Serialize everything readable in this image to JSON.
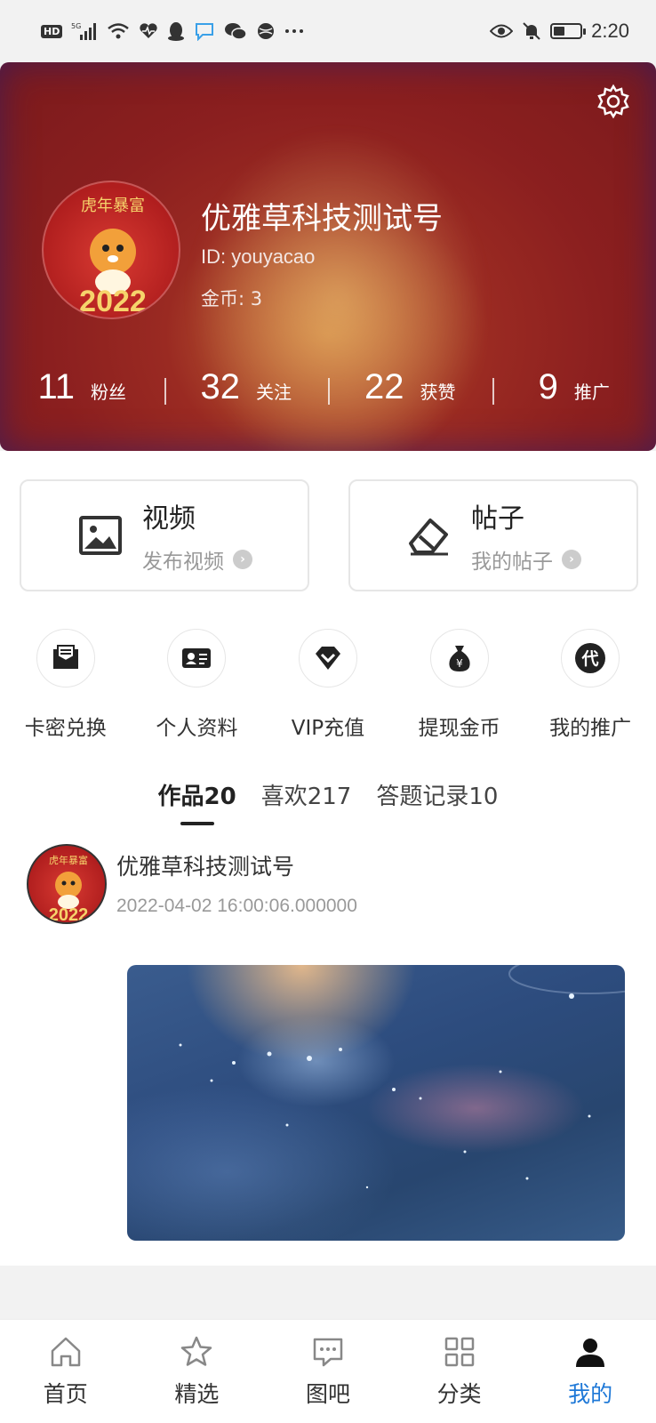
{
  "status_bar": {
    "left_icons": [
      "hd-icon",
      "signal-5g-icon",
      "signal-bars-icon",
      "wifi-icon",
      "health-icon",
      "qq-icon",
      "chat-bubble-icon",
      "wechat-icon",
      "globe-icon",
      "more-dots-icon"
    ],
    "hd_label": "HD",
    "time": "2:20"
  },
  "profile": {
    "name": "优雅草科技测试号",
    "id_text": "ID: youyacao",
    "coins_text": "金币: 3",
    "avatar_text": "虎年暴富 2022",
    "stats": [
      {
        "value": "11",
        "label": "粉丝"
      },
      {
        "value": "32",
        "label": "关注"
      },
      {
        "value": "22",
        "label": "获赞"
      },
      {
        "value": "9",
        "label": "推广"
      }
    ]
  },
  "cards": [
    {
      "title": "视频",
      "subtitle": "发布视频",
      "icon": "image-icon"
    },
    {
      "title": "帖子",
      "subtitle": "我的帖子",
      "icon": "eraser-icon"
    }
  ],
  "shortcuts": [
    {
      "label": "卡密兑换",
      "icon": "inbox-icon"
    },
    {
      "label": "个人资料",
      "icon": "id-card-icon"
    },
    {
      "label": "VIP充值",
      "icon": "diamond-icon"
    },
    {
      "label": "提现金币",
      "icon": "money-bag-icon"
    },
    {
      "label": "我的推广",
      "icon": "agent-icon",
      "glyph": "代"
    }
  ],
  "tabs": [
    {
      "label": "作品20",
      "active": true
    },
    {
      "label": "喜欢217",
      "active": false
    },
    {
      "label": "答题记录10",
      "active": false
    }
  ],
  "post": {
    "author": "优雅草科技测试号",
    "timestamp": "2022-04-02 16:00:06.000000"
  },
  "bottom_nav": [
    {
      "label": "首页",
      "icon": "home-icon",
      "active": false
    },
    {
      "label": "精选",
      "icon": "star-icon",
      "active": false
    },
    {
      "label": "图吧",
      "icon": "message-icon",
      "active": false
    },
    {
      "label": "分类",
      "icon": "grid-icon",
      "active": false
    },
    {
      "label": "我的",
      "icon": "user-icon",
      "active": true
    }
  ],
  "colors": {
    "accent": "#1e78d7",
    "header_red": "#8b1f1f"
  }
}
